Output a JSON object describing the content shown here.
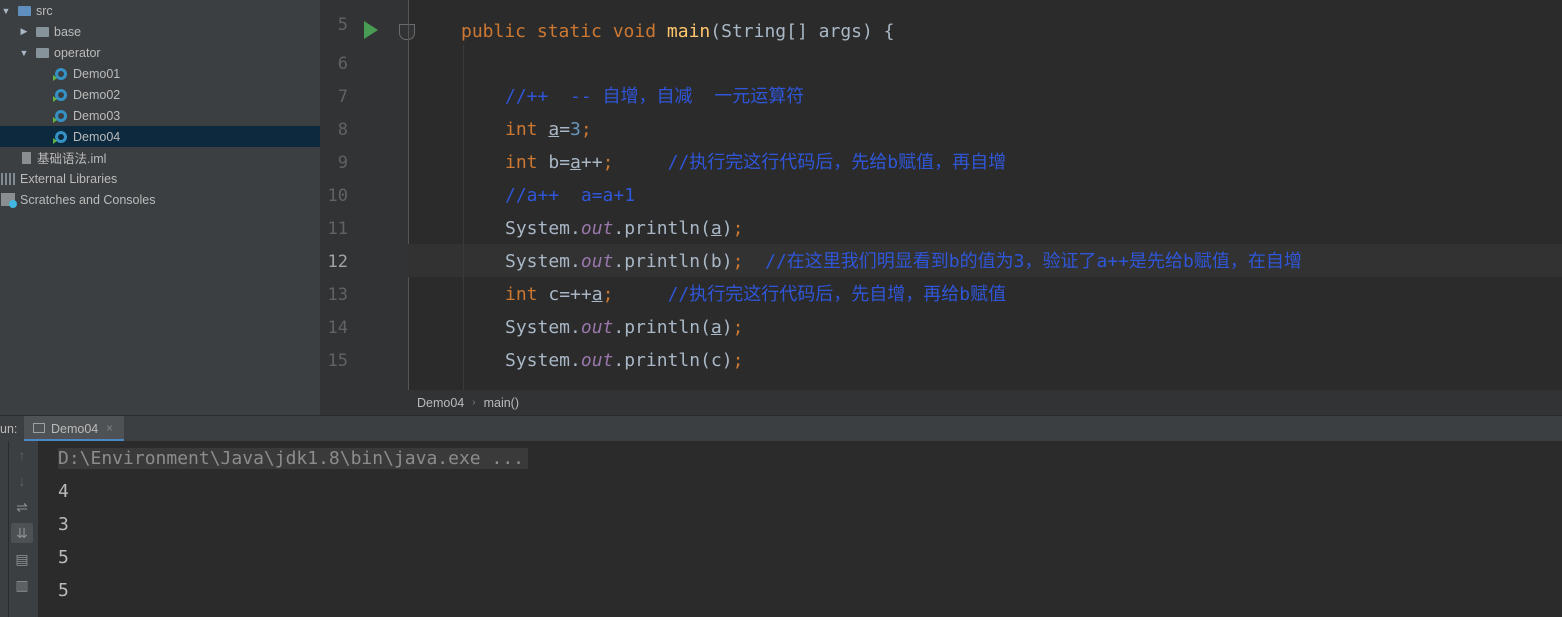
{
  "project_tree": {
    "items": [
      {
        "label": "src",
        "kind": "source-folder",
        "expanded": true
      },
      {
        "label": "base",
        "kind": "package",
        "expanded": false
      },
      {
        "label": "operator",
        "kind": "package",
        "expanded": true
      },
      {
        "label": "Demo01",
        "kind": "class"
      },
      {
        "label": "Demo02",
        "kind": "class"
      },
      {
        "label": "Demo03",
        "kind": "class"
      },
      {
        "label": "Demo04",
        "kind": "class",
        "selected": true
      },
      {
        "label": "基础语法.iml",
        "kind": "iml-file"
      },
      {
        "label": "External Libraries",
        "kind": "libraries"
      },
      {
        "label": "Scratches and Consoles",
        "kind": "scratches"
      }
    ]
  },
  "editor": {
    "line_numbers": [
      "5",
      "6",
      "7",
      "8",
      "9",
      "10",
      "11",
      "12",
      "13",
      "14",
      "15"
    ],
    "current_line": "12",
    "lines": {
      "l5": {
        "kw": "public static void",
        "fn": "main",
        "rest": "(String[] args) {"
      },
      "l7": {
        "comment": "//++  -- 自增，自减  一元运算符"
      },
      "l8": {
        "kw": "int",
        "var": "a",
        "eq": "=",
        "num": "3",
        "semi": ";"
      },
      "l9": {
        "kw": "int",
        "pre": "b=",
        "var": "a",
        "post": "++",
        "semi": ";",
        "comment": "//执行完这行代码后，先给b赋值，再自增"
      },
      "l10": {
        "comment": "//a++  a=a+1"
      },
      "l11": {
        "cls": "System.",
        "field": "out",
        "call": ".println(",
        "arg": "a",
        "close": ")",
        "semi": ";"
      },
      "l12": {
        "cls": "System.",
        "field": "out",
        "call": ".println(b)",
        "semi": ";",
        "comment": "//在这里我们明显看到b的值为3，验证了a++是先给b赋值，在自增"
      },
      "l13": {
        "kw": "int",
        "pre": "c=++",
        "var": "a",
        "semi": ";",
        "comment": "//执行完这行代码后，先自增，再给b赋值"
      },
      "l14": {
        "cls": "System.",
        "field": "out",
        "call": ".println(",
        "arg": "a",
        "close": ")",
        "semi": ";"
      },
      "l15": {
        "cls": "System.",
        "field": "out",
        "call": ".println(c)",
        "semi": ";"
      }
    }
  },
  "breadcrumb": {
    "class": "Demo04",
    "method": "main()"
  },
  "run_panel": {
    "label": "un:",
    "tab": "Demo04",
    "command": "D:\\Environment\\Java\\jdk1.8\\bin\\java.exe ...",
    "output": [
      "4",
      "3",
      "5",
      "5"
    ]
  },
  "colors": {
    "keyword": "#cc7832",
    "function": "#ffc66d",
    "number": "#6897bb",
    "comment": "#2f56d8",
    "field": "#9876aa",
    "selection": "#0d293e"
  }
}
